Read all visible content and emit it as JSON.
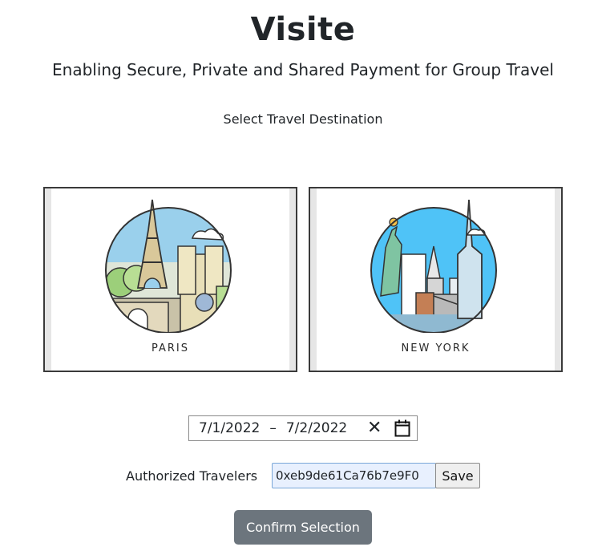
{
  "header": {
    "title": "Visite",
    "subtitle": "Enabling Secure, Private and Shared Payment for Group Travel"
  },
  "destinations": {
    "section_label": "Select Travel Destination",
    "items": [
      {
        "label": "PARIS",
        "icon": "paris-eiffel-tower-illustration"
      },
      {
        "label": "NEW YORK",
        "icon": "new-york-skyline-illustration"
      }
    ]
  },
  "dates": {
    "start": "7/1/2022",
    "separator": "–",
    "end": "7/2/2022",
    "clear_icon": "✕",
    "calendar_icon": "calendar-icon"
  },
  "travelers": {
    "label": "Authorized Travelers",
    "value": "0xeb9de61Ca76b7e9F0",
    "save_label": "Save"
  },
  "actions": {
    "confirm_label": "Confirm Selection"
  },
  "colors": {
    "confirm_bg": "#6c757d",
    "input_bg": "#e8f0fe",
    "sky": "#4fc3f7",
    "paris_sky": "#9ad0ec"
  }
}
